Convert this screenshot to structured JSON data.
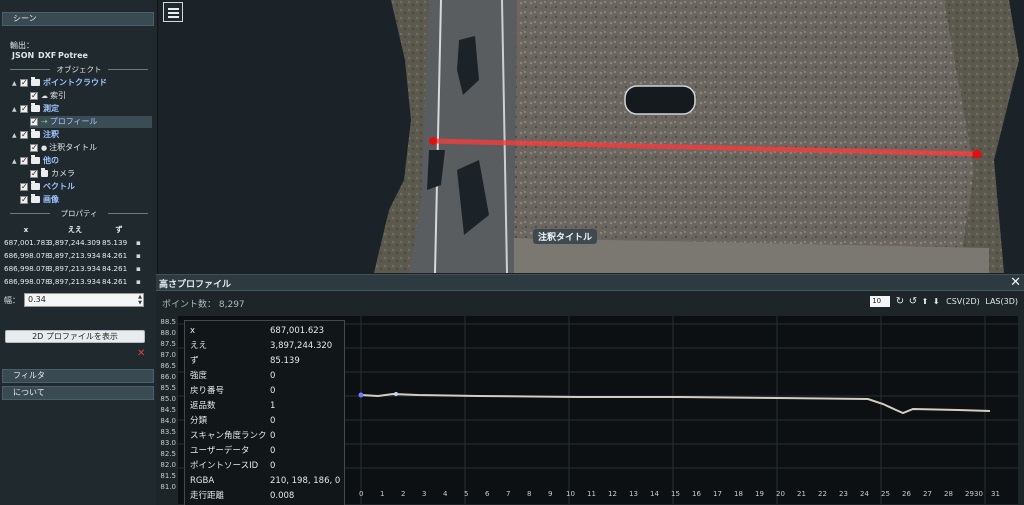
{
  "sidebar": {
    "scene_label": "シーン",
    "export_label": "輸出：",
    "export_formats": [
      "JSON",
      "DXF",
      "Potree"
    ],
    "objects_title": "オブジェクト",
    "tree": [
      {
        "label": "ポイントクラウド",
        "kind": "folder"
      },
      {
        "label": "索引",
        "kind": "item"
      },
      {
        "label": "測定",
        "kind": "folder"
      },
      {
        "label": "プロフィール",
        "kind": "item"
      },
      {
        "label": "注釈",
        "kind": "folder"
      },
      {
        "label": "注釈タイトル",
        "kind": "item"
      },
      {
        "label": "他の",
        "kind": "folder"
      },
      {
        "label": "カメラ",
        "kind": "item"
      },
      {
        "label": "ベクトル",
        "kind": "folder"
      },
      {
        "label": "画像",
        "kind": "folder"
      }
    ],
    "properties_title": "プロパティ",
    "table_headers": [
      "x",
      "ええ",
      "ず"
    ],
    "table_rows": [
      [
        "687,001.783",
        "3,897,244.309",
        "85.139"
      ],
      [
        "686,998.078",
        "3,897,213.934",
        "84.261"
      ],
      [
        "686,998.078",
        "3,897,213.934",
        "84.261"
      ],
      [
        "686,998.078",
        "3,897,213.934",
        "84.261"
      ]
    ],
    "width_label": "幅：",
    "width_value": "0.34",
    "show_2d_button": "2D プロファイルを表示",
    "filter_label": "フィルタ",
    "about_label": "について"
  },
  "viewport": {
    "annotation_label": "注釈タイトル"
  },
  "profile": {
    "title": "高さプロファイル",
    "point_count_label": "ポイント数：",
    "point_count": "8,297",
    "threshold": "10",
    "csv_label": "CSV(2D)",
    "las_label": "LAS(3D)",
    "y_ticks": [
      "88.5",
      "88.0",
      "87.5",
      "87.0",
      "86.5",
      "86.0",
      "85.5",
      "85.0",
      "84.5",
      "84.0",
      "83.5",
      "83.0",
      "82.5",
      "82.0",
      "81.5",
      "81.0"
    ],
    "x_ticks": [
      "0",
      "1",
      "2",
      "3",
      "4",
      "5",
      "6",
      "7",
      "8",
      "9",
      "10",
      "11",
      "12",
      "13",
      "14",
      "15",
      "16",
      "17",
      "18",
      "19",
      "20",
      "21",
      "22",
      "23",
      "24",
      "25",
      "26",
      "27",
      "28",
      "29",
      "30",
      "31"
    ],
    "info": [
      {
        "key": "x",
        "value": "687,001.623"
      },
      {
        "key": "ええ",
        "value": "3,897,244.320"
      },
      {
        "key": "ず",
        "value": "85.139"
      },
      {
        "key": "強度",
        "value": "0"
      },
      {
        "key": "戻り番号",
        "value": "0"
      },
      {
        "key": "返品数",
        "value": "1"
      },
      {
        "key": "分類",
        "value": "0"
      },
      {
        "key": "スキャン角度ランク",
        "value": "0"
      },
      {
        "key": "ユーザーデータ",
        "value": "0"
      },
      {
        "key": "ポイントソースID",
        "value": "0"
      },
      {
        "key": "RGBA",
        "value": "210, 198, 186, 0"
      },
      {
        "key": "走行距離",
        "value": "0.008"
      }
    ]
  },
  "colors": {
    "accent_blue": "#9ec4ff",
    "profile_line": "#ff4040",
    "close_red": "#e04040"
  }
}
